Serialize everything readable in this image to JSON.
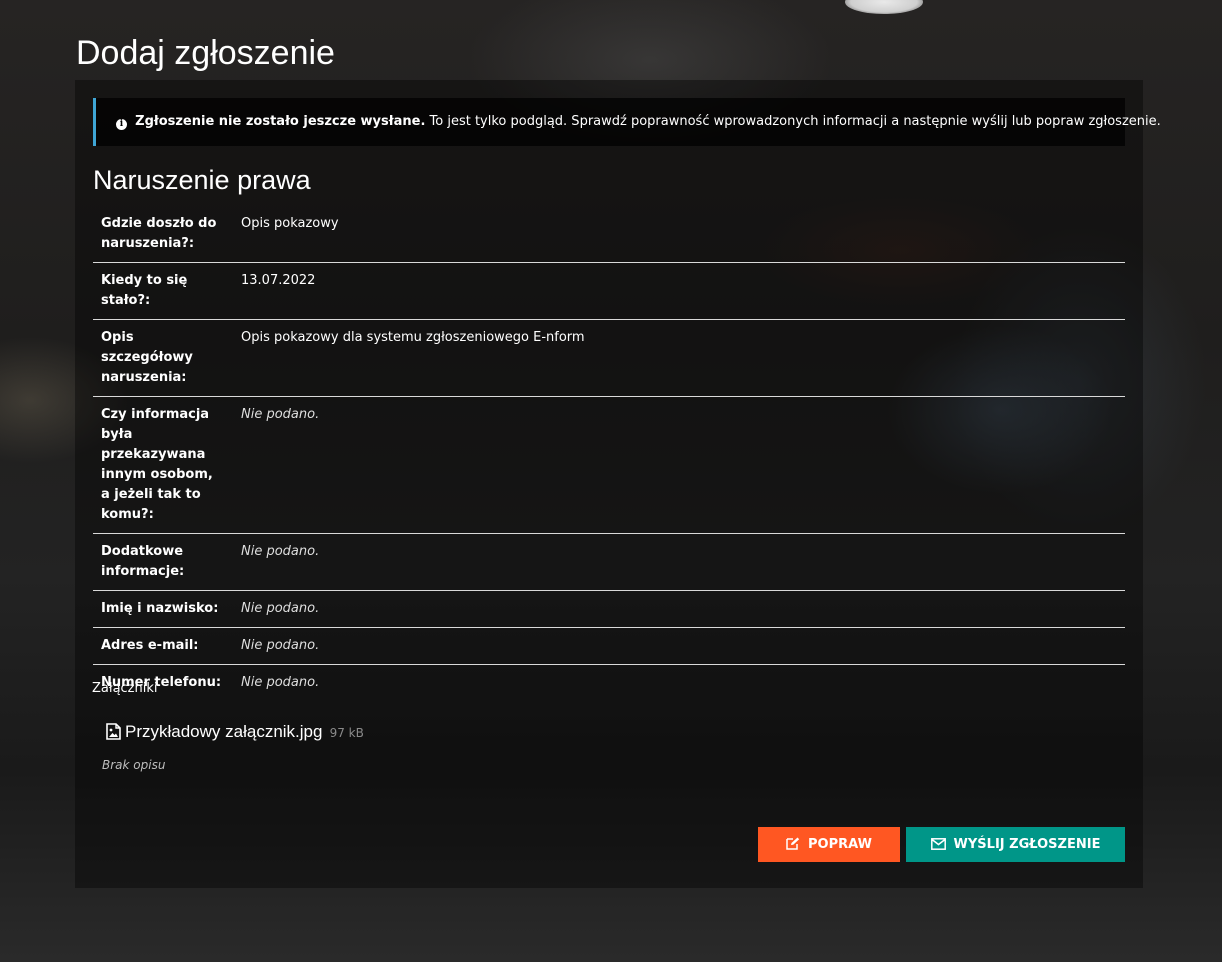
{
  "page": {
    "title": "Dodaj zgłoszenie"
  },
  "alert": {
    "strong": "Zgłoszenie nie zostało jeszcze wysłane.",
    "text": " To jest tylko podgląd. Sprawdź poprawność wprowadzonych informacji a następnie wyślij lub popraw zgłoszenie.",
    "icon": "info-circle-icon",
    "accent_color": "#3fa6d6"
  },
  "section": {
    "title": "Naruszenie prawa"
  },
  "fields": [
    {
      "label": "Gdzie doszło do naruszenia?:",
      "value": "Opis pokazowy"
    },
    {
      "label": "Kiedy to się stało?:",
      "value": "13.07.2022"
    },
    {
      "label": "Opis szczegółowy naruszenia:",
      "value": "Opis pokazowy dla systemu zgłoszeniowego E-nform"
    },
    {
      "label": "Czy informacja była przekazywana innym osobom, a jeżeli tak to komu?:",
      "value": "Nie podano."
    },
    {
      "label": "Dodatkowe informacje:",
      "value": "Nie podano."
    },
    {
      "label": "Imię i nazwisko:",
      "value": "Nie podano."
    },
    {
      "label": "Adres e-mail:",
      "value": "Nie podano."
    },
    {
      "label": "Numer telefonu:",
      "value": "Nie podano."
    }
  ],
  "attachments": {
    "heading": "Załączniki",
    "items": [
      {
        "name": "Przykładowy załącznik.jpg",
        "size": "97 kB",
        "description": "Brak opisu",
        "icon": "image-file-icon"
      }
    ]
  },
  "buttons": {
    "fix": {
      "label": "POPRAW",
      "icon": "edit-icon",
      "color": "#ff5722"
    },
    "send": {
      "label": "WYŚLIJ ZGŁOSZENIE",
      "icon": "envelope-icon",
      "color": "#009688"
    }
  }
}
